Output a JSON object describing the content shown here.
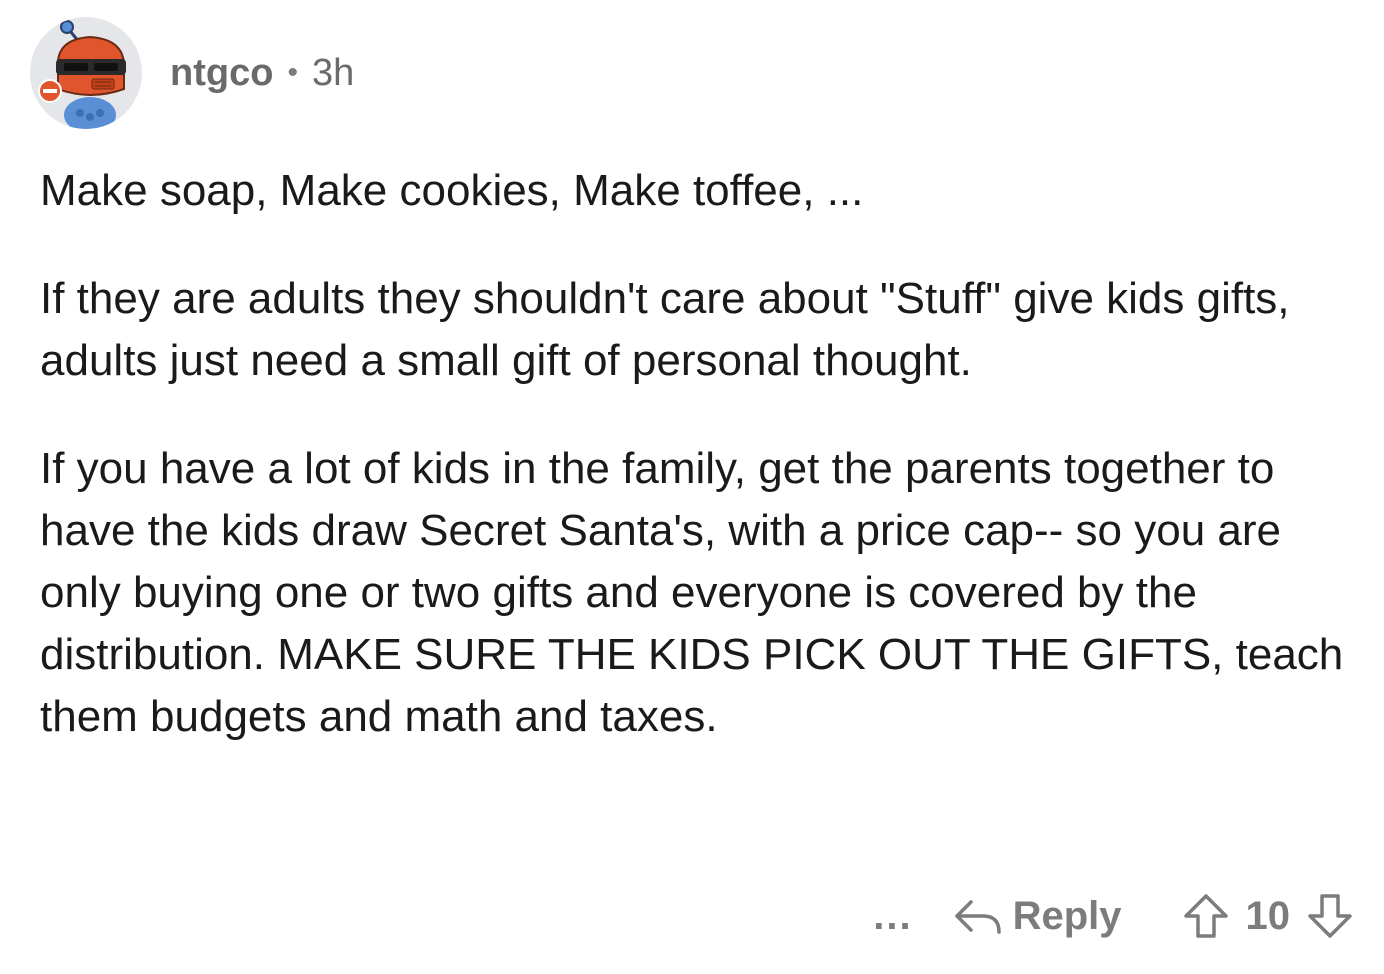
{
  "comment": {
    "author": "ntgco",
    "separator": "•",
    "age": "3h",
    "avatar_icon": "snoo-robot-avatar-icon",
    "paragraphs": [
      "Make soap, Make cookies, Make toffee, ...",
      "If they are adults they shouldn't care about \"Stuff\" give kids gifts, adults just need a small gift of personal thought.",
      "If you have a lot of kids in the family, get the parents together to have the kids draw Secret Santa's, with a price cap--  so you are only buying one or two gifts and everyone is covered by the distribution. MAKE SURE THE KIDS PICK OUT THE GIFTS, teach them budgets and math and taxes."
    ]
  },
  "actions": {
    "more_label": "...",
    "reply_label": "Reply",
    "reply_icon": "reply-arrow-icon",
    "upvote_icon": "upvote-arrow-icon",
    "downvote_icon": "downvote-arrow-icon",
    "score": "10"
  },
  "colors": {
    "muted": "#7c7c7c",
    "text": "#1a1a1b",
    "avatar_bg": "#e4e6e9",
    "avatar_orange": "#e0552b",
    "avatar_blue": "#5a8fd6"
  }
}
